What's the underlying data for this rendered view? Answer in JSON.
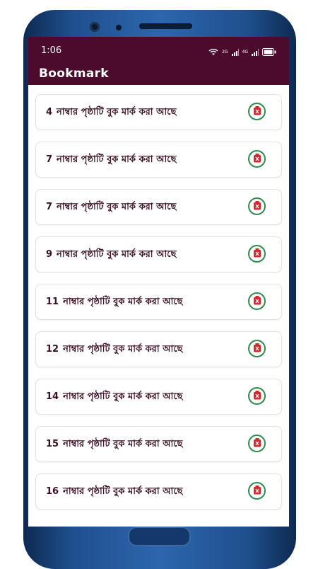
{
  "status_bar": {
    "time": "1:06",
    "net_2g": "2G",
    "net_4g": "4G",
    "icons": [
      "wifi-icon",
      "signal-icon",
      "signal-icon",
      "battery-icon"
    ]
  },
  "app_bar": {
    "title": "Bookmark"
  },
  "bookmark_text": "নাম্বার পৃষ্ঠাটি বুক মার্ক করা আছে",
  "bookmarks": [
    {
      "page": "4"
    },
    {
      "page": "7"
    },
    {
      "page": "7"
    },
    {
      "page": "9"
    },
    {
      "page": "11"
    },
    {
      "page": "12"
    },
    {
      "page": "14"
    },
    {
      "page": "15"
    },
    {
      "page": "16"
    }
  ],
  "colors": {
    "header": "#4c0a2c",
    "item_text": "#3c0e22",
    "delete_ring": "#2f8b4c",
    "delete_icon": "#d8262e",
    "phone_frame": "#1f4f8e"
  }
}
